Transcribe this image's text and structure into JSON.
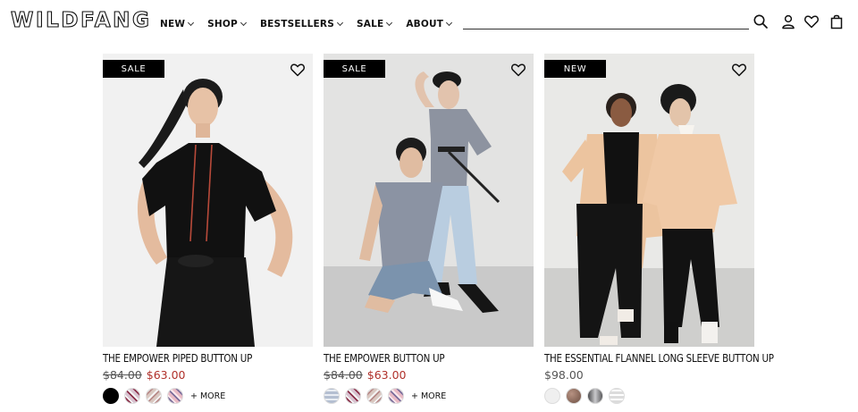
{
  "brand": {
    "logo": "WILDFANG"
  },
  "nav": [
    {
      "label": "NEW"
    },
    {
      "label": "SHOP"
    },
    {
      "label": "BESTSELLERS"
    },
    {
      "label": "SALE"
    },
    {
      "label": "ABOUT"
    }
  ],
  "header_icons": [
    "search-icon",
    "account-icon",
    "heart-icon",
    "bag-icon"
  ],
  "products": [
    {
      "badge": "SALE",
      "title": "THE EMPOWER PIPED BUTTON UP",
      "old_price": "$84.00",
      "price": "$63.00",
      "more": "+ MORE",
      "swatches": [
        "#000000",
        "#d8c2d0",
        "#d9c7c0",
        "#e8b9c4"
      ]
    },
    {
      "badge": "SALE",
      "title": "THE EMPOWER BUTTON UP",
      "old_price": "$84.00",
      "price": "$63.00",
      "more": "+ MORE",
      "swatches": [
        "#b4bfd1",
        "#d8c2d0",
        "#d9c7c0",
        "#e8b9c4"
      ]
    },
    {
      "badge": "NEW",
      "title": "THE ESSENTIAL FLANNEL LONG SLEEVE BUTTON UP",
      "price": "$98.00",
      "swatches": [
        "#efefef",
        "#8a6e62",
        "#7d7d80",
        "#dcdcdc"
      ]
    }
  ],
  "colors": {
    "sale_price": "#b0312b",
    "badge_bg": "#000000"
  }
}
